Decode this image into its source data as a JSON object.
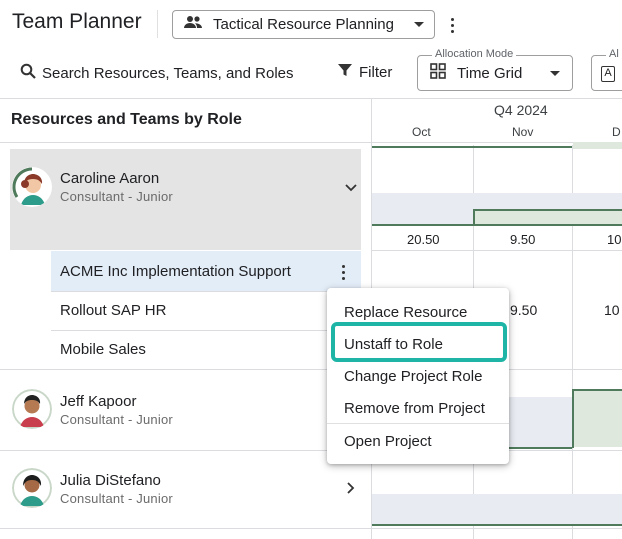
{
  "app": {
    "title": "Team Planner"
  },
  "plan_selector": {
    "label": "Tactical Resource Planning",
    "icon": "people-icon"
  },
  "toolbar": {
    "search_label": "Search Resources, Teams, and Roles",
    "filter_label": "Filter",
    "allocation_mode": {
      "legend": "Allocation Mode",
      "value": "Time Grid",
      "icon": "grid-icon"
    },
    "second_select": {
      "legend": "Al"
    }
  },
  "grid": {
    "left_header": "Resources and Teams by Role",
    "quarter": "Q4 2024",
    "months": [
      "Oct",
      "Nov",
      "D"
    ]
  },
  "resources": [
    {
      "name": "Caroline Aaron",
      "role": "Consultant - Junior",
      "values": [
        "20.50",
        "9.50",
        "10"
      ]
    },
    {
      "name": "Jeff Kapoor",
      "role": "Consultant - Junior"
    },
    {
      "name": "Julia DiStefano",
      "role": "Consultant - Junior"
    }
  ],
  "projects": [
    {
      "name": "ACME Inc Implementation Support"
    },
    {
      "name": "Rollout SAP HR",
      "values": [
        "9.50",
        "10"
      ]
    },
    {
      "name": "Mobile Sales"
    }
  ],
  "context_menu": {
    "items": [
      "Replace Resource",
      "Unstaff to Role",
      "Change Project Role",
      "Remove from Project",
      "Open Project"
    ],
    "highlighted": "Unstaff to Role"
  },
  "colors": {
    "highlight": "#1fb5a6",
    "selected_row": "#e4e4e4",
    "active_project": "#e3edf8",
    "timeline_line": "#4f7a5c"
  }
}
